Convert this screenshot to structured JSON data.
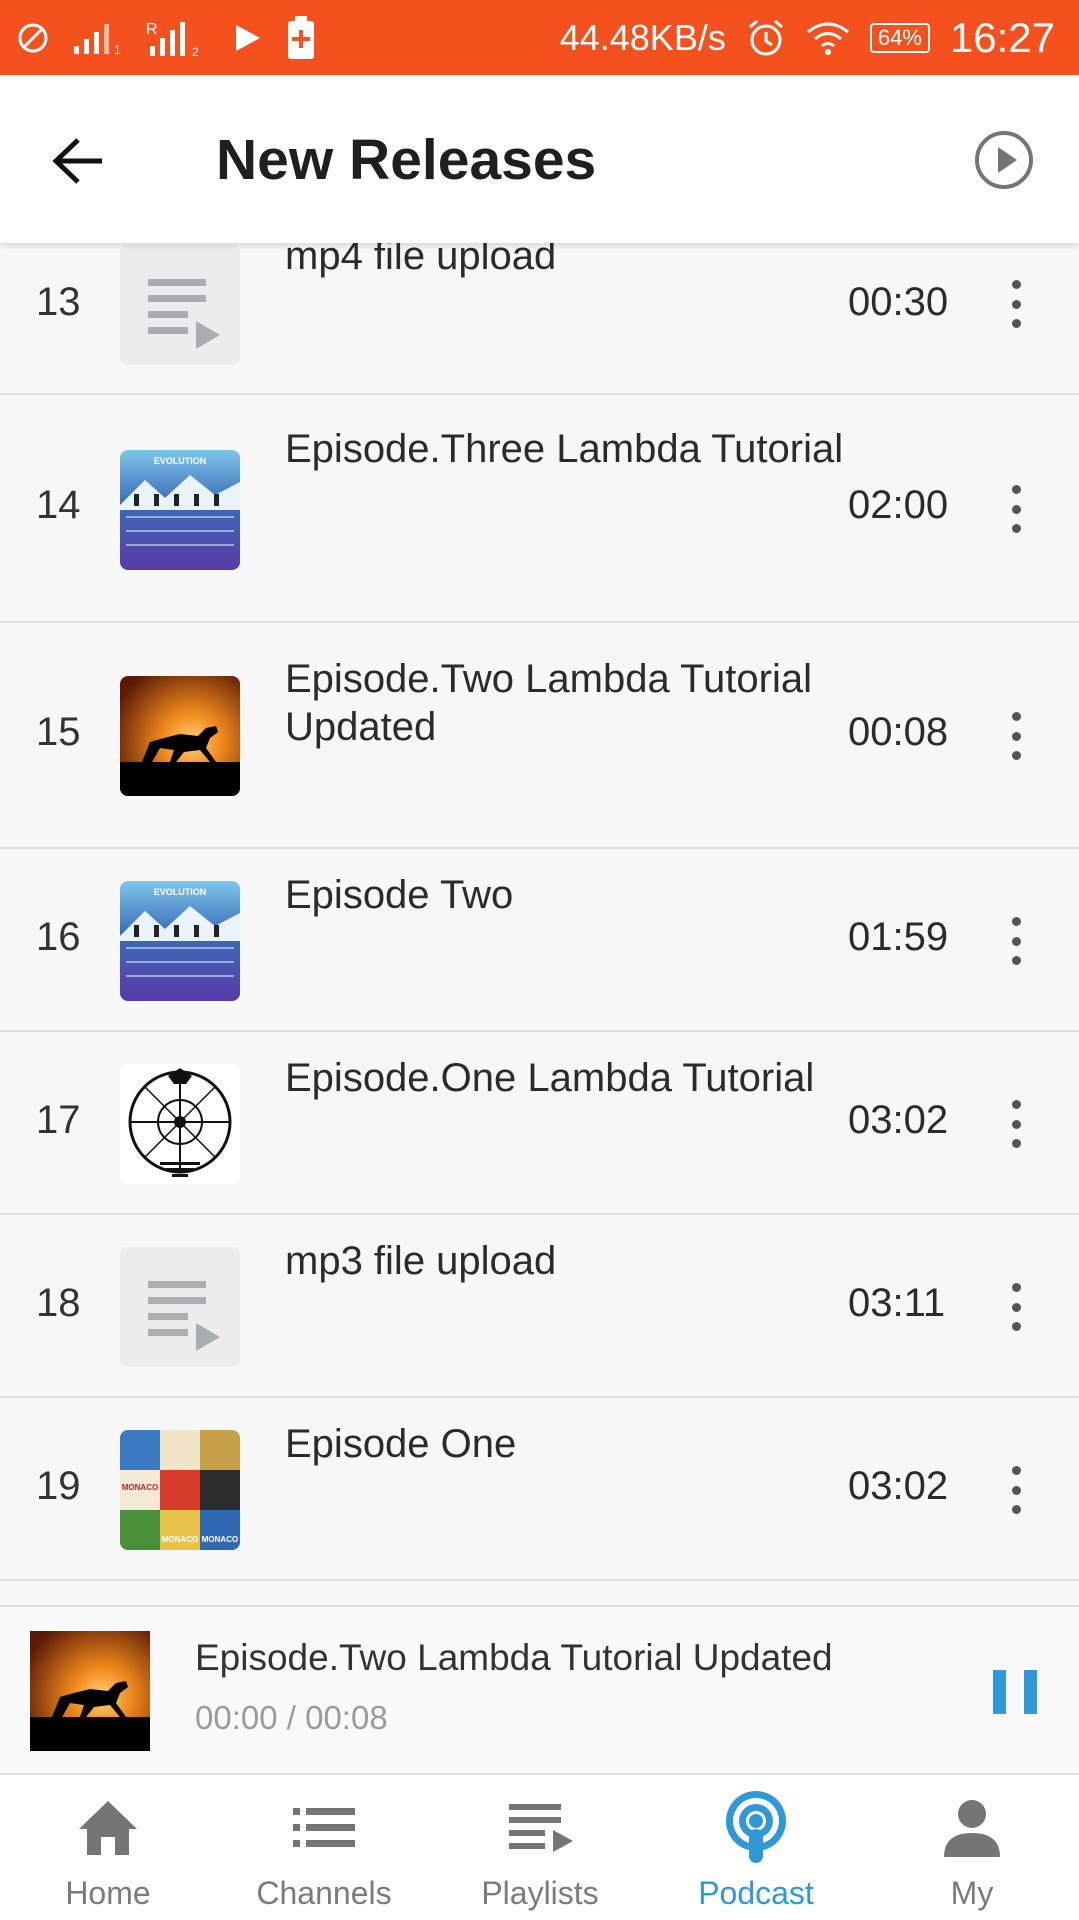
{
  "status_bar": {
    "network_speed": "44.48KB/s",
    "battery": "64%",
    "time": "16:27",
    "bg_color": "#f4511e",
    "icons": [
      "no-sim-icon",
      "signal-icon",
      "signal-roaming-icon",
      "play-store-icon",
      "battery-saver-icon",
      "alarm-icon",
      "wifi-icon",
      "battery-icon"
    ]
  },
  "header": {
    "title": "New Releases",
    "back_icon": "arrow-left-icon",
    "play_all_icon": "play-circle-icon"
  },
  "episodes": [
    {
      "index": "13",
      "title": "mp4 file upload",
      "duration": "00:30",
      "thumbnail": "playlist-placeholder"
    },
    {
      "index": "14",
      "title": "Episode.Three Lambda Tutorial",
      "duration": "02:00",
      "thumbnail": "evolution-poster"
    },
    {
      "index": "15",
      "title": "Episode.Two Lambda Tutorial Updated",
      "duration": "00:08",
      "thumbnail": "horse-sunset"
    },
    {
      "index": "16",
      "title": "Episode Two",
      "duration": "01:59",
      "thumbnail": "evolution-poster"
    },
    {
      "index": "17",
      "title": "Episode.One Lambda Tutorial",
      "duration": "03:02",
      "thumbnail": "test-pattern"
    },
    {
      "index": "18",
      "title": "mp3 file upload",
      "duration": "03:11",
      "thumbnail": "playlist-placeholder"
    },
    {
      "index": "19",
      "title": "Episode One",
      "duration": "03:02",
      "thumbnail": "monaco-posters"
    }
  ],
  "now_playing": {
    "title": "Episode.Two Lambda Tutorial Updated",
    "time": "00:00 / 00:08",
    "thumbnail": "horse-sunset"
  },
  "nav": {
    "items": [
      {
        "label": "Home",
        "icon": "home-icon"
      },
      {
        "label": "Channels",
        "icon": "list-icon"
      },
      {
        "label": "Playlists",
        "icon": "playlist-play-icon"
      },
      {
        "label": "Podcast",
        "icon": "podcast-icon",
        "active": true
      },
      {
        "label": "My",
        "icon": "person-icon"
      }
    ],
    "active_color": "#2f98d6"
  }
}
